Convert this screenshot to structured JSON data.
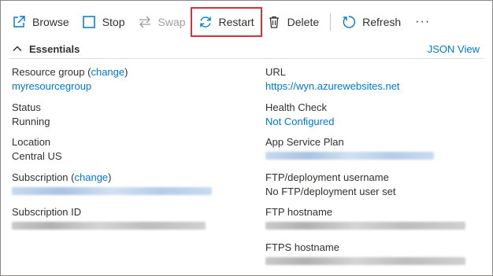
{
  "toolbar": {
    "browse": "Browse",
    "stop": "Stop",
    "swap": "Swap",
    "restart": "Restart",
    "delete": "Delete",
    "refresh": "Refresh",
    "more": "···"
  },
  "essentials": {
    "title": "Essentials",
    "json_view": "JSON View"
  },
  "left": {
    "resource_group_label": "Resource group",
    "resource_group_change_open": "(",
    "resource_group_change": "change",
    "resource_group_change_close": ")",
    "resource_group_value": "myresourcegroup",
    "status_label": "Status",
    "status_value": "Running",
    "location_label": "Location",
    "location_value": "Central US",
    "subscription_label": "Subscription",
    "subscription_change_open": "(",
    "subscription_change": "change",
    "subscription_change_close": ")",
    "subscription_id_label": "Subscription ID"
  },
  "right": {
    "url_label": "URL",
    "url_value": "https://wyn.azurewebsites.net",
    "health_label": "Health Check",
    "health_value": "Not Configured",
    "plan_label": "App Service Plan",
    "ftp_user_label": "FTP/deployment username",
    "ftp_user_value": "No FTP/deployment user set",
    "ftp_host_label": "FTP hostname",
    "ftps_host_label": "FTPS hostname"
  },
  "colors": {
    "accent": "#0078d4",
    "highlight_border": "#d13438"
  }
}
